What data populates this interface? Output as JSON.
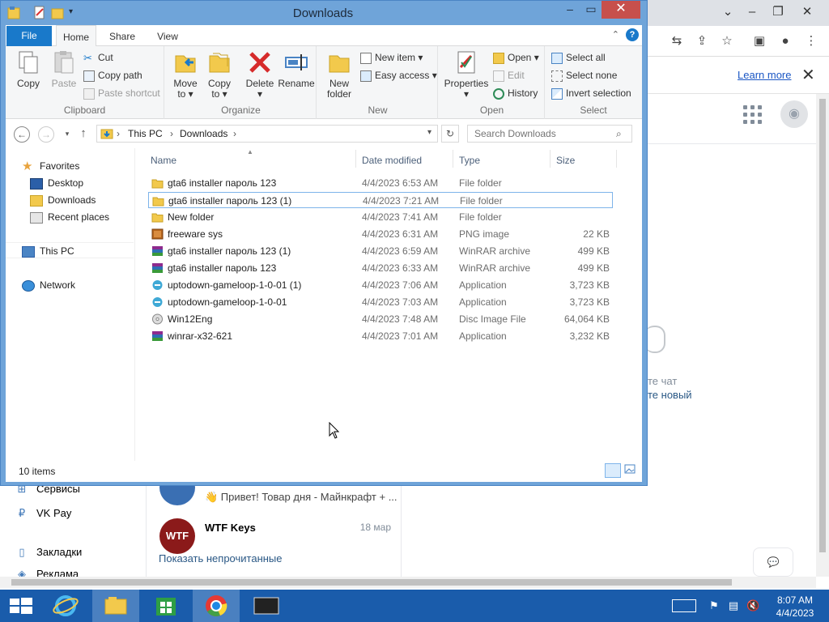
{
  "browser": {
    "learn_more": "Learn more",
    "vk": {
      "chat_hint_line1": "те чат",
      "chat_hint_line2": "те новый",
      "left_items": [
        {
          "label": "Сервисы",
          "icon": "services-icon"
        },
        {
          "label": "VK Pay",
          "icon": "vkpay-icon"
        },
        {
          "label": "Закладки",
          "icon": "bookmark-icon"
        },
        {
          "label": "Реклама",
          "icon": "ads-icon"
        }
      ],
      "messages": [
        {
          "title": "",
          "text": "👋 Привет! Товар дня - Майнкрафт + ...",
          "date": ""
        },
        {
          "title": "WTF Keys",
          "text": "",
          "date": "18 мар",
          "avatar_text": "WTF"
        }
      ],
      "show_unread": "Показать непрочитанные"
    }
  },
  "explorer": {
    "title": "Downloads",
    "ribbon_tabs": {
      "file": "File",
      "home": "Home",
      "share": "Share",
      "view": "View"
    },
    "ribbon": {
      "clipboard": {
        "label": "Clipboard",
        "copy": "Copy",
        "paste": "Paste",
        "cut": "Cut",
        "copy_path": "Copy path",
        "paste_shortcut": "Paste shortcut"
      },
      "organize": {
        "label": "Organize",
        "move_to_1": "Move",
        "move_to_2": "to ▾",
        "copy_to_1": "Copy",
        "copy_to_2": "to ▾",
        "delete_1": "Delete",
        "delete_2": "▾",
        "rename": "Rename"
      },
      "new": {
        "label": "New",
        "new_folder_1": "New",
        "new_folder_2": "folder",
        "new_item": "New item ▾",
        "easy_access": "Easy access ▾"
      },
      "open": {
        "label": "Open",
        "properties_1": "Properties",
        "properties_2": "▾",
        "open": "Open ▾",
        "edit": "Edit",
        "history": "History"
      },
      "select": {
        "label": "Select",
        "select_all": "Select all",
        "select_none": "Select none",
        "invert_selection": "Invert selection"
      }
    },
    "address": {
      "crumbs": [
        "This PC",
        "Downloads"
      ],
      "search_placeholder": "Search Downloads"
    },
    "nav_pane": {
      "favorites": "Favorites",
      "desktop": "Desktop",
      "downloads": "Downloads",
      "recent_places": "Recent places",
      "this_pc": "This PC",
      "network": "Network"
    },
    "columns": {
      "name": "Name",
      "date": "Date modified",
      "type": "Type",
      "size": "Size"
    },
    "files": [
      {
        "name": "gta6 installer пароль 123",
        "date": "4/4/2023 6:53 AM",
        "type": "File folder",
        "size": "",
        "icon": "folder-icon"
      },
      {
        "name": "gta6 installer пароль 123 (1)",
        "date": "4/4/2023 7:21 AM",
        "type": "File folder",
        "size": "",
        "icon": "folder-icon",
        "selected": true
      },
      {
        "name": "New folder",
        "date": "4/4/2023 7:41 AM",
        "type": "File folder",
        "size": "",
        "icon": "folder-icon"
      },
      {
        "name": "freeware sys",
        "date": "4/4/2023 6:31 AM",
        "type": "PNG image",
        "size": "22 KB",
        "icon": "png-icon"
      },
      {
        "name": "gta6 installer пароль 123 (1)",
        "date": "4/4/2023 6:59 AM",
        "type": "WinRAR archive",
        "size": "499 KB",
        "icon": "winrar-icon"
      },
      {
        "name": "gta6 installer пароль 123",
        "date": "4/4/2023 6:33 AM",
        "type": "WinRAR archive",
        "size": "499 KB",
        "icon": "winrar-icon"
      },
      {
        "name": "uptodown-gameloop-1-0-01 (1)",
        "date": "4/4/2023 7:06 AM",
        "type": "Application",
        "size": "3,723 KB",
        "icon": "gameloop-icon"
      },
      {
        "name": "uptodown-gameloop-1-0-01",
        "date": "4/4/2023 7:03 AM",
        "type": "Application",
        "size": "3,723 KB",
        "icon": "gameloop-icon"
      },
      {
        "name": "Win12Eng",
        "date": "4/4/2023 7:48 AM",
        "type": "Disc Image File",
        "size": "64,064 KB",
        "icon": "disc-icon"
      },
      {
        "name": "winrar-x32-621",
        "date": "4/4/2023 7:01 AM",
        "type": "Application",
        "size": "3,232 KB",
        "icon": "winrar-icon"
      }
    ],
    "status": "10 items"
  },
  "taskbar": {
    "time": "8:07 AM",
    "date": "4/4/2023"
  },
  "colors": {
    "accent": "#1979ca",
    "titlebar": "#6fa4d9",
    "taskbar": "#1a5cab",
    "close": "#c7504c"
  }
}
